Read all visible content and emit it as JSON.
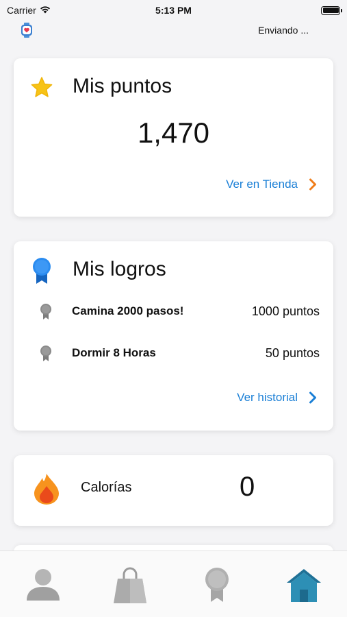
{
  "status_bar": {
    "carrier": "Carrier",
    "time": "5:13 PM"
  },
  "header": {
    "sync_status": "Enviando ...",
    "watch_icon": "smartwatch-heart-icon"
  },
  "points_card": {
    "title": "Mis puntos",
    "value": "1,470",
    "link_label": "Ver en Tienda",
    "icon": "star-icon",
    "link_color": "#1a7fd6",
    "chevron_color": "#f07d1a"
  },
  "achievements_card": {
    "title": "Mis logros",
    "icon": "medal-icon",
    "items": [
      {
        "name": "Camina 2000 pasos!",
        "points": "1000 puntos"
      },
      {
        "name": "Dormir 8 Horas",
        "points": "50 puntos"
      }
    ],
    "link_label": "Ver historial"
  },
  "calories_card": {
    "label": "Calorías",
    "value": "0",
    "icon": "flame-icon"
  },
  "tab_bar": {
    "items": [
      {
        "name": "profile",
        "icon": "user-icon",
        "active": false
      },
      {
        "name": "store",
        "icon": "shopping-bag-icon",
        "active": false
      },
      {
        "name": "achievements",
        "icon": "medal-icon",
        "active": false
      },
      {
        "name": "home",
        "icon": "home-icon",
        "active": true
      }
    ],
    "active_color": "#2d8fb5"
  }
}
